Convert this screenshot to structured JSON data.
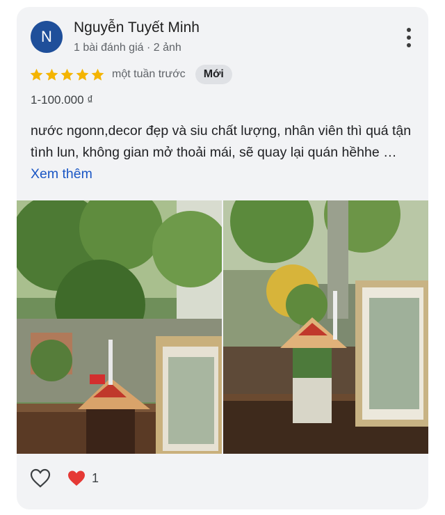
{
  "review": {
    "avatar_initial": "N",
    "author_name": "Nguyễn Tuyết Minh",
    "author_meta": "1 bài đánh giá · 2 ảnh",
    "rating": 5,
    "time_ago": "một tuần trước",
    "new_badge": "Mới",
    "price_range": "1-100.000 ₫",
    "text": "nước ngonn,decor đẹp và siu chất lượng, nhân viên thì quá tận tình lun, không gian mở thoải mái, sẽ quay lại quán hềhhe …",
    "read_more": "Xem thêm",
    "reaction_count": "1"
  },
  "colors": {
    "star": "#f4b400",
    "avatar_bg": "#1f4f9a",
    "link": "#1a56c4",
    "heart": "#e53935"
  },
  "icons": {
    "more": "more-vert-icon",
    "like": "heart-outline-icon",
    "reaction": "red-heart-icon"
  }
}
